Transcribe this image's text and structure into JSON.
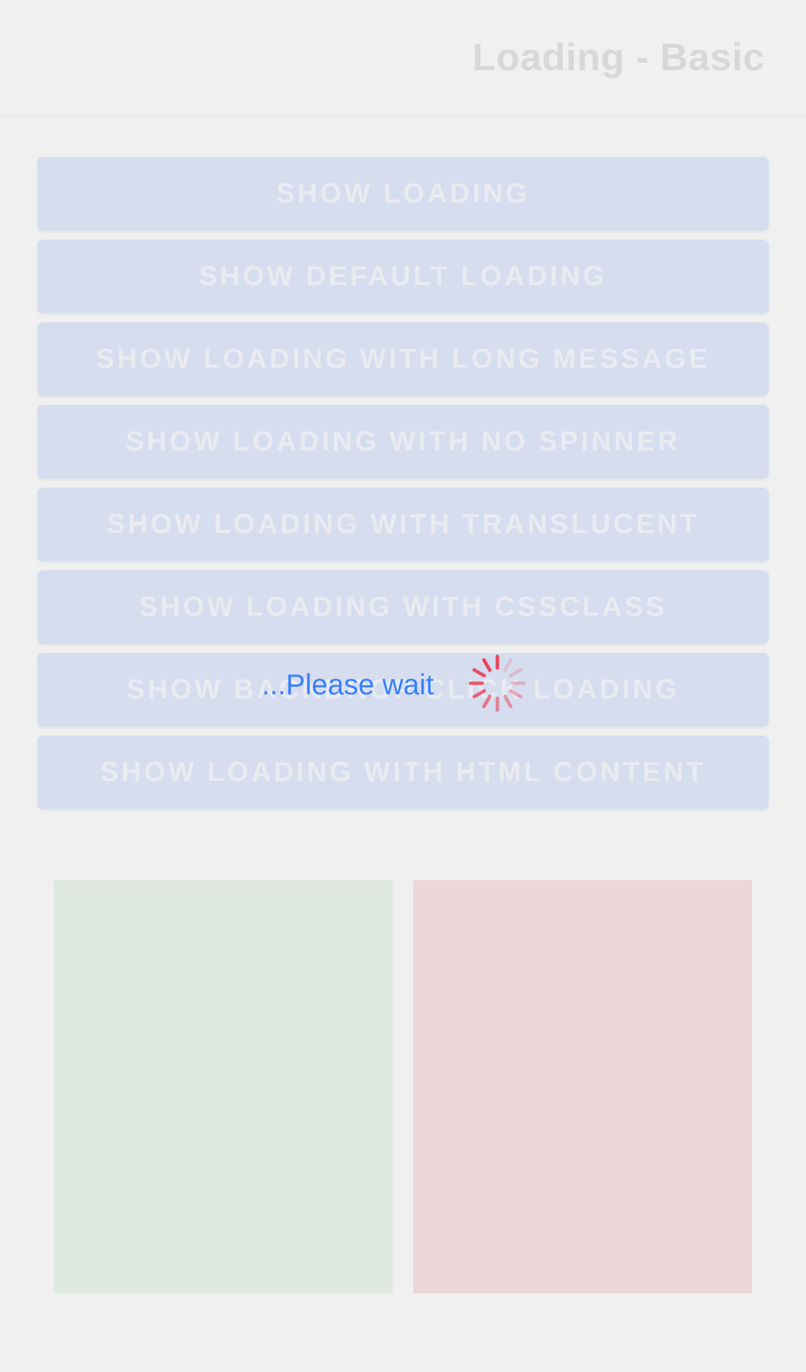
{
  "header": {
    "title": "Loading - Basic"
  },
  "buttons": [
    {
      "label": "Show Loading"
    },
    {
      "label": "Show Default Loading"
    },
    {
      "label": "Show Loading with long message"
    },
    {
      "label": "Show Loading with no spinner"
    },
    {
      "label": "Show Loading with translucent"
    },
    {
      "label": "Show Loading with cssclass"
    },
    {
      "label": "Show Backdrop Click Loading"
    },
    {
      "label": "Show Loading with HTML content"
    }
  ],
  "loading": {
    "message": "...Please wait",
    "spinner_icon": "lines-spinner-icon"
  },
  "colors": {
    "accent": "#3880ff",
    "spinner": "#eb445a",
    "button_bg": "#d5ddef",
    "box_green": "#dfe9e0",
    "box_pink": "#ebd6da"
  }
}
